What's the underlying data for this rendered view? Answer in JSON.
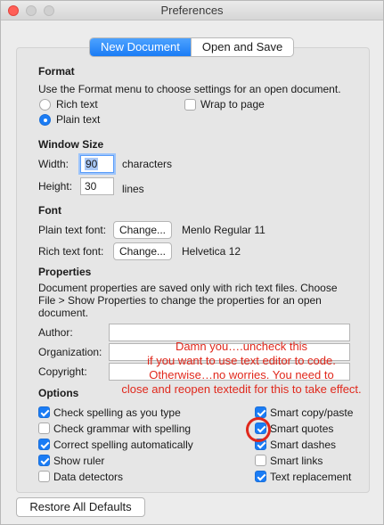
{
  "window": {
    "title": "Preferences"
  },
  "tabs": [
    {
      "label": "New Document",
      "active": true
    },
    {
      "label": "Open and Save",
      "active": false
    }
  ],
  "format": {
    "heading": "Format",
    "description": "Use the Format menu to choose settings for an open document.",
    "rich_text_label": "Rich text",
    "plain_text_label": "Plain text",
    "selected": "Plain text",
    "wrap_to_page_label": "Wrap to page",
    "wrap_to_page_checked": false
  },
  "window_size": {
    "heading": "Window Size",
    "width_label": "Width:",
    "width_value": "90",
    "width_unit": "characters",
    "height_label": "Height:",
    "height_value": "30",
    "height_unit": "lines"
  },
  "font": {
    "heading": "Font",
    "plain_label": "Plain text font:",
    "plain_button": "Change...",
    "plain_value": "Menlo Regular 11",
    "rich_label": "Rich text font:",
    "rich_button": "Change...",
    "rich_value": "Helvetica 12"
  },
  "properties": {
    "heading": "Properties",
    "description_1": "Document properties are saved only with rich text files. Choose",
    "description_2": "File > Show Properties to change the properties for an open",
    "description_3": "document.",
    "author_label": "Author:",
    "organization_label": "Organization:",
    "copyright_label": "Copyright:",
    "author_value": "",
    "organization_value": "",
    "copyright_value": ""
  },
  "annotation": {
    "text": "Damn you….uncheck this\nif you want to use text editor to code.\nOtherwise…no worries. You need to\nclose and reopen textedit for this to take effect.",
    "color": "#e0281c"
  },
  "options": {
    "heading": "Options",
    "left": [
      {
        "label": "Check spelling as you type",
        "checked": true
      },
      {
        "label": "Check grammar with spelling",
        "checked": false
      },
      {
        "label": "Correct spelling automatically",
        "checked": true
      },
      {
        "label": "Show ruler",
        "checked": true
      },
      {
        "label": "Data detectors",
        "checked": false
      }
    ],
    "right": [
      {
        "label": "Smart copy/paste",
        "checked": true
      },
      {
        "label": "Smart quotes",
        "checked": true
      },
      {
        "label": "Smart dashes",
        "checked": true
      },
      {
        "label": "Smart links",
        "checked": false
      },
      {
        "label": "Text replacement",
        "checked": true
      }
    ]
  },
  "footer": {
    "restore_label": "Restore All Defaults"
  },
  "colors": {
    "accent": "#1a7cf5",
    "annotation": "#e0281c"
  }
}
